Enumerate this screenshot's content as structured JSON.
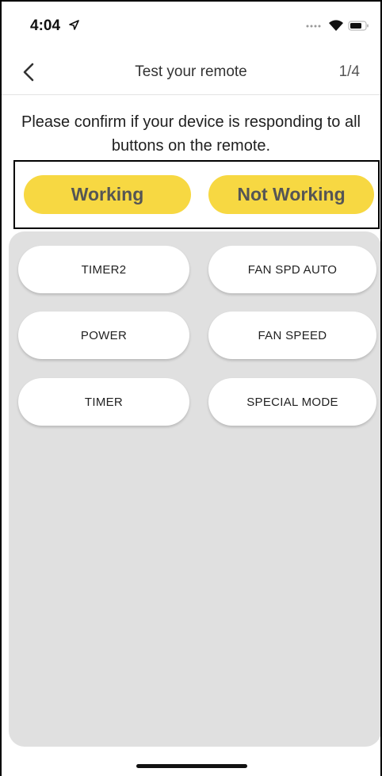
{
  "status_bar": {
    "time": "4:04"
  },
  "nav": {
    "title": "Test your remote",
    "step": "1/4"
  },
  "instruction": "Please confirm if your device is responding to all buttons on the remote.",
  "confirm": {
    "working_label": "Working",
    "not_working_label": "Not Working",
    "accent_color": "#f7d842"
  },
  "remote_buttons": [
    {
      "label": "TIMER2"
    },
    {
      "label": "FAN SPD AUTO"
    },
    {
      "label": "POWER"
    },
    {
      "label": "FAN SPEED"
    },
    {
      "label": "TIMER"
    },
    {
      "label": "SPECIAL MODE"
    }
  ],
  "icons": {
    "back": "chevron-left-icon",
    "location": "location-arrow-icon",
    "wifi": "wifi-icon",
    "battery": "battery-icon"
  }
}
